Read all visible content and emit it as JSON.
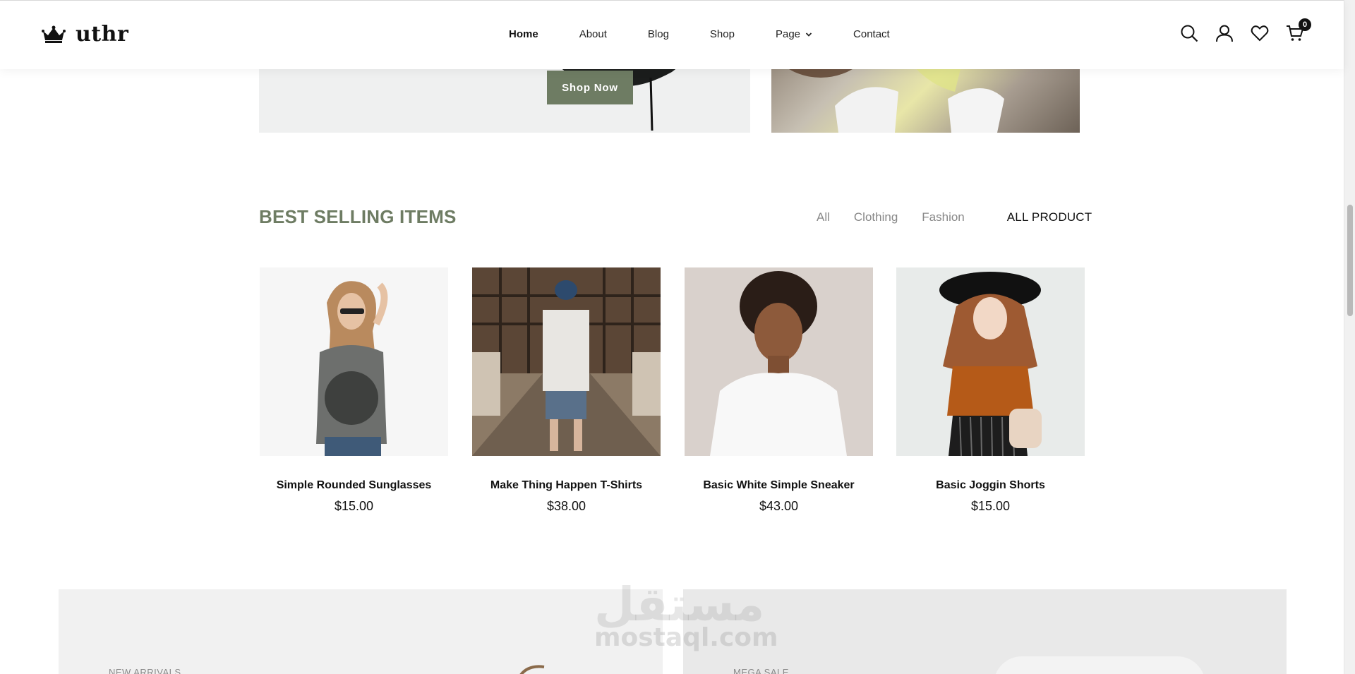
{
  "header": {
    "logo_text": "uthr",
    "nav": [
      {
        "label": "Home",
        "active": true
      },
      {
        "label": "About"
      },
      {
        "label": "Blog"
      },
      {
        "label": "Shop"
      },
      {
        "label": "Page",
        "dropdown": true
      },
      {
        "label": "Contact"
      }
    ],
    "icons": [
      "search-icon",
      "user-icon",
      "heart-icon",
      "cart-icon"
    ],
    "cart_count": "0"
  },
  "hero": {
    "shop_now_label": "Shop Now"
  },
  "best_selling": {
    "title": "BEST SELLING ITEMS",
    "filters": [
      "All",
      "Clothing",
      "Fashion"
    ],
    "all_product_label": "ALL PRODUCT",
    "products": [
      {
        "name": "Simple Rounded Sunglasses",
        "price": "$15.00"
      },
      {
        "name": "Make Thing Happen T-Shirts",
        "price": "$38.00"
      },
      {
        "name": "Basic White Simple Sneaker",
        "price": "$43.00"
      },
      {
        "name": "Basic Joggin Shorts",
        "price": "$15.00"
      }
    ]
  },
  "promos": {
    "left_label": "NEW ARRIVALS",
    "right_label": "MEGA SALE"
  },
  "watermark": {
    "arabic": "مستقل",
    "latin": "mostaql.com"
  },
  "colors": {
    "accent": "#6e7c63",
    "text": "#111111",
    "muted": "#888888"
  }
}
